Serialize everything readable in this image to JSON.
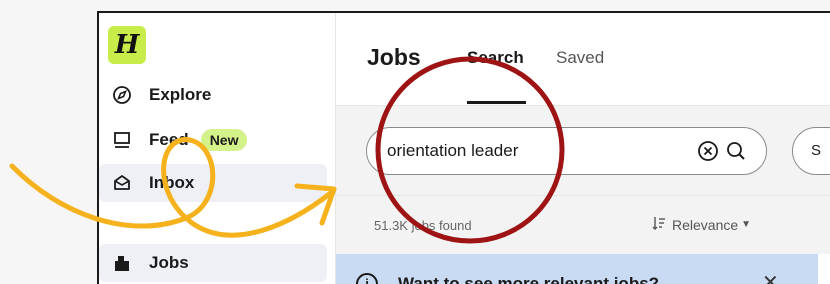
{
  "logo": {
    "text": "H"
  },
  "sidebar": {
    "items": [
      {
        "label": "Explore",
        "icon": "compass-icon"
      },
      {
        "label": "Feed",
        "icon": "feed-icon",
        "badge": "New"
      },
      {
        "label": "Inbox",
        "icon": "inbox-icon"
      },
      {
        "label": "Jobs",
        "icon": "briefcase-icon"
      }
    ]
  },
  "header": {
    "title": "Jobs",
    "tabs": [
      {
        "label": "Search",
        "active": true
      },
      {
        "label": "Saved",
        "active": false
      }
    ]
  },
  "search": {
    "value": "orientation leader",
    "next_chip_label": "S"
  },
  "results": {
    "count_text": "51.3K jobs found",
    "sort_label": "Relevance"
  },
  "banner": {
    "text": "Want to see more relevant jobs?"
  },
  "colors": {
    "logo_green": "#c8ec4a",
    "badge_green": "#d4f28a",
    "annotation_red": "#9e1414",
    "annotation_arrow": "#f5b21c",
    "banner_blue": "#c9daf3"
  }
}
